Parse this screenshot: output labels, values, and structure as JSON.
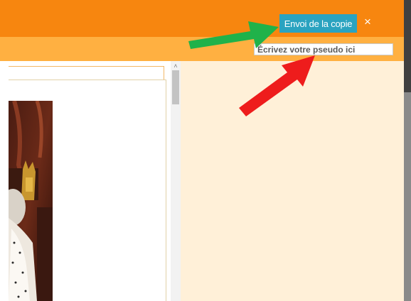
{
  "header": {
    "send_label": "Envoi de la copie",
    "close_label": "×"
  },
  "pseudo": {
    "placeholder": "Écrivez votre pseudo ici"
  },
  "scrollbar": {
    "up_arrow": "˄"
  },
  "colors": {
    "top_bar": "#f7860f",
    "sub_bar": "#ffb041",
    "send_button": "#2aa3c0",
    "right_panel": "#fff0d8",
    "green_arrow": "#20b24a",
    "red_arrow": "#ee1c1c"
  },
  "icons": {
    "close": "close-icon",
    "scroll_up": "chevron-up-icon",
    "green_arrow": "arrow-right-icon",
    "red_arrow": "arrow-up-right-icon"
  }
}
